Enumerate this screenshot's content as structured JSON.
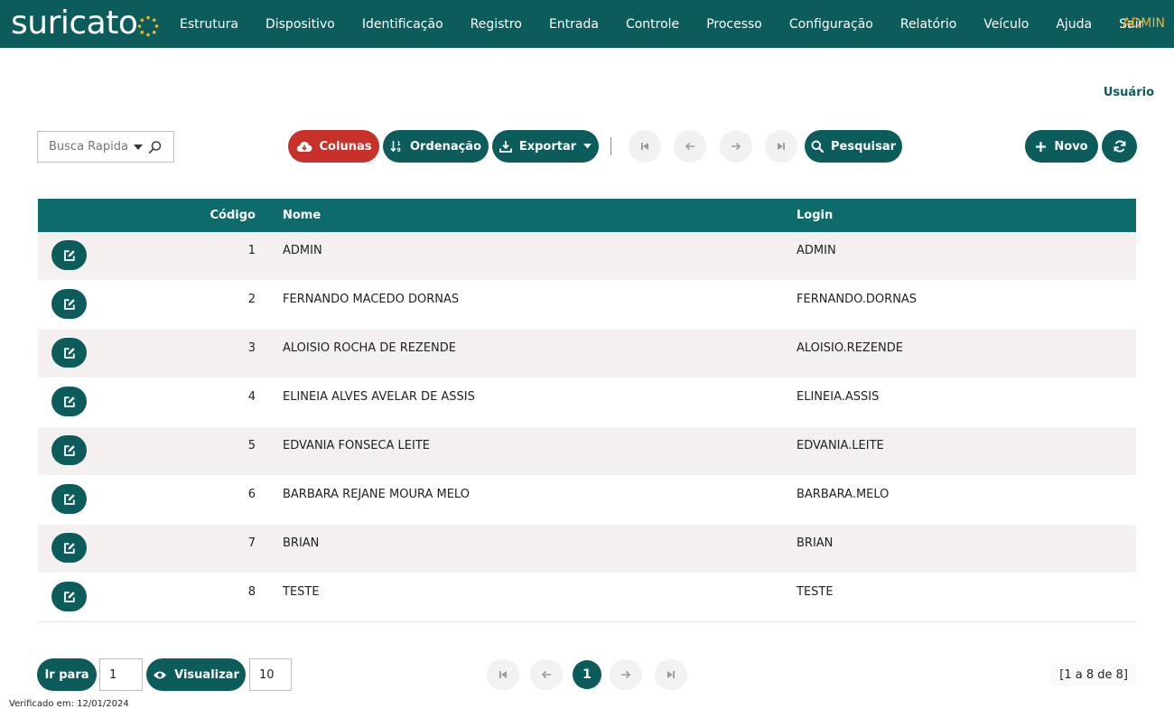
{
  "brand": {
    "logo_text": "suricato",
    "accent": "#f2b22a",
    "primary": "#0d5c5c",
    "danger": "#c8302a"
  },
  "nav": {
    "items": [
      "Estrutura",
      "Dispositivo",
      "Identificação",
      "Registro",
      "Entrada",
      "Controle",
      "Processo",
      "Configuração",
      "Relatório",
      "Veículo",
      "Ajuda",
      "Sair"
    ],
    "user": "ADMIN"
  },
  "page": {
    "title": "Usuário"
  },
  "toolbar": {
    "quick_search_placeholder": "Busca Rapida",
    "columns_label": "Colunas",
    "sort_label": "Ordenação",
    "export_label": "Exportar",
    "search_label": "Pesquisar",
    "new_label": "Novo"
  },
  "table": {
    "headers": {
      "code": "Código",
      "name": "Nome",
      "login": "Login"
    },
    "rows": [
      {
        "code": "1",
        "name": "ADMIN",
        "login": "ADMIN"
      },
      {
        "code": "2",
        "name": "FERNANDO MACEDO DORNAS",
        "login": "FERNANDO.DORNAS"
      },
      {
        "code": "3",
        "name": "ALOISIO ROCHA DE REZENDE",
        "login": "ALOISIO.REZENDE"
      },
      {
        "code": "4",
        "name": "ELINEIA ALVES AVELAR DE ASSIS",
        "login": "ELINEIA.ASSIS"
      },
      {
        "code": "5",
        "name": "EDVANIA FONSECA LEITE",
        "login": "EDVANIA.LEITE"
      },
      {
        "code": "6",
        "name": "BARBARA REJANE MOURA MELO",
        "login": "BARBARA.MELO"
      },
      {
        "code": "7",
        "name": "BRIAN",
        "login": "BRIAN"
      },
      {
        "code": "8",
        "name": "TESTE",
        "login": "TESTE"
      }
    ]
  },
  "pagination": {
    "goto_label": "Ir para",
    "goto_value": "1",
    "view_label": "Visualizar",
    "view_value": "10",
    "current_page": "1",
    "range_text": "[1 a 8 de 8]"
  },
  "footer": {
    "verified_text": "Verificado em: 12/01/2024"
  }
}
